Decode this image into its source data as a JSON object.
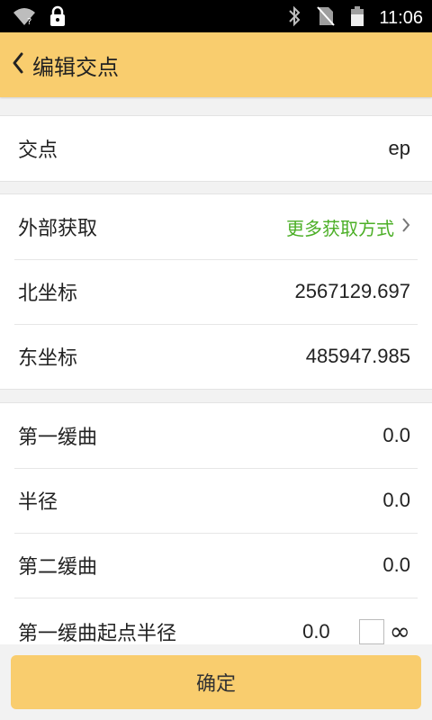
{
  "status_bar": {
    "time": "11:06",
    "icons": [
      "wifi-question-icon",
      "lock-icon",
      "bluetooth-icon",
      "no-sim-icon",
      "battery-icon"
    ]
  },
  "header": {
    "title": "编辑交点",
    "back_icon": "chevron-left-icon"
  },
  "sections": {
    "point": {
      "label": "交点",
      "value": "ep"
    },
    "coords": {
      "external_label": "外部获取",
      "external_link": "更多获取方式",
      "north_label": "北坐标",
      "north_value": "2567129.697",
      "east_label": "东坐标",
      "east_value": "485947.985"
    },
    "curve": {
      "first_spiral_label": "第一缓曲",
      "first_spiral_value": "0.0",
      "radius_label": "半径",
      "radius_value": "0.0",
      "second_spiral_label": "第二缓曲",
      "second_spiral_value": "0.0",
      "start_radius_label": "第一缓曲起点半径",
      "start_radius_value": "0.0",
      "infinity_symbol": "∞"
    }
  },
  "footer": {
    "confirm_label": "确定"
  },
  "colors": {
    "accent": "#f9cd6e",
    "link": "#4caf27"
  }
}
